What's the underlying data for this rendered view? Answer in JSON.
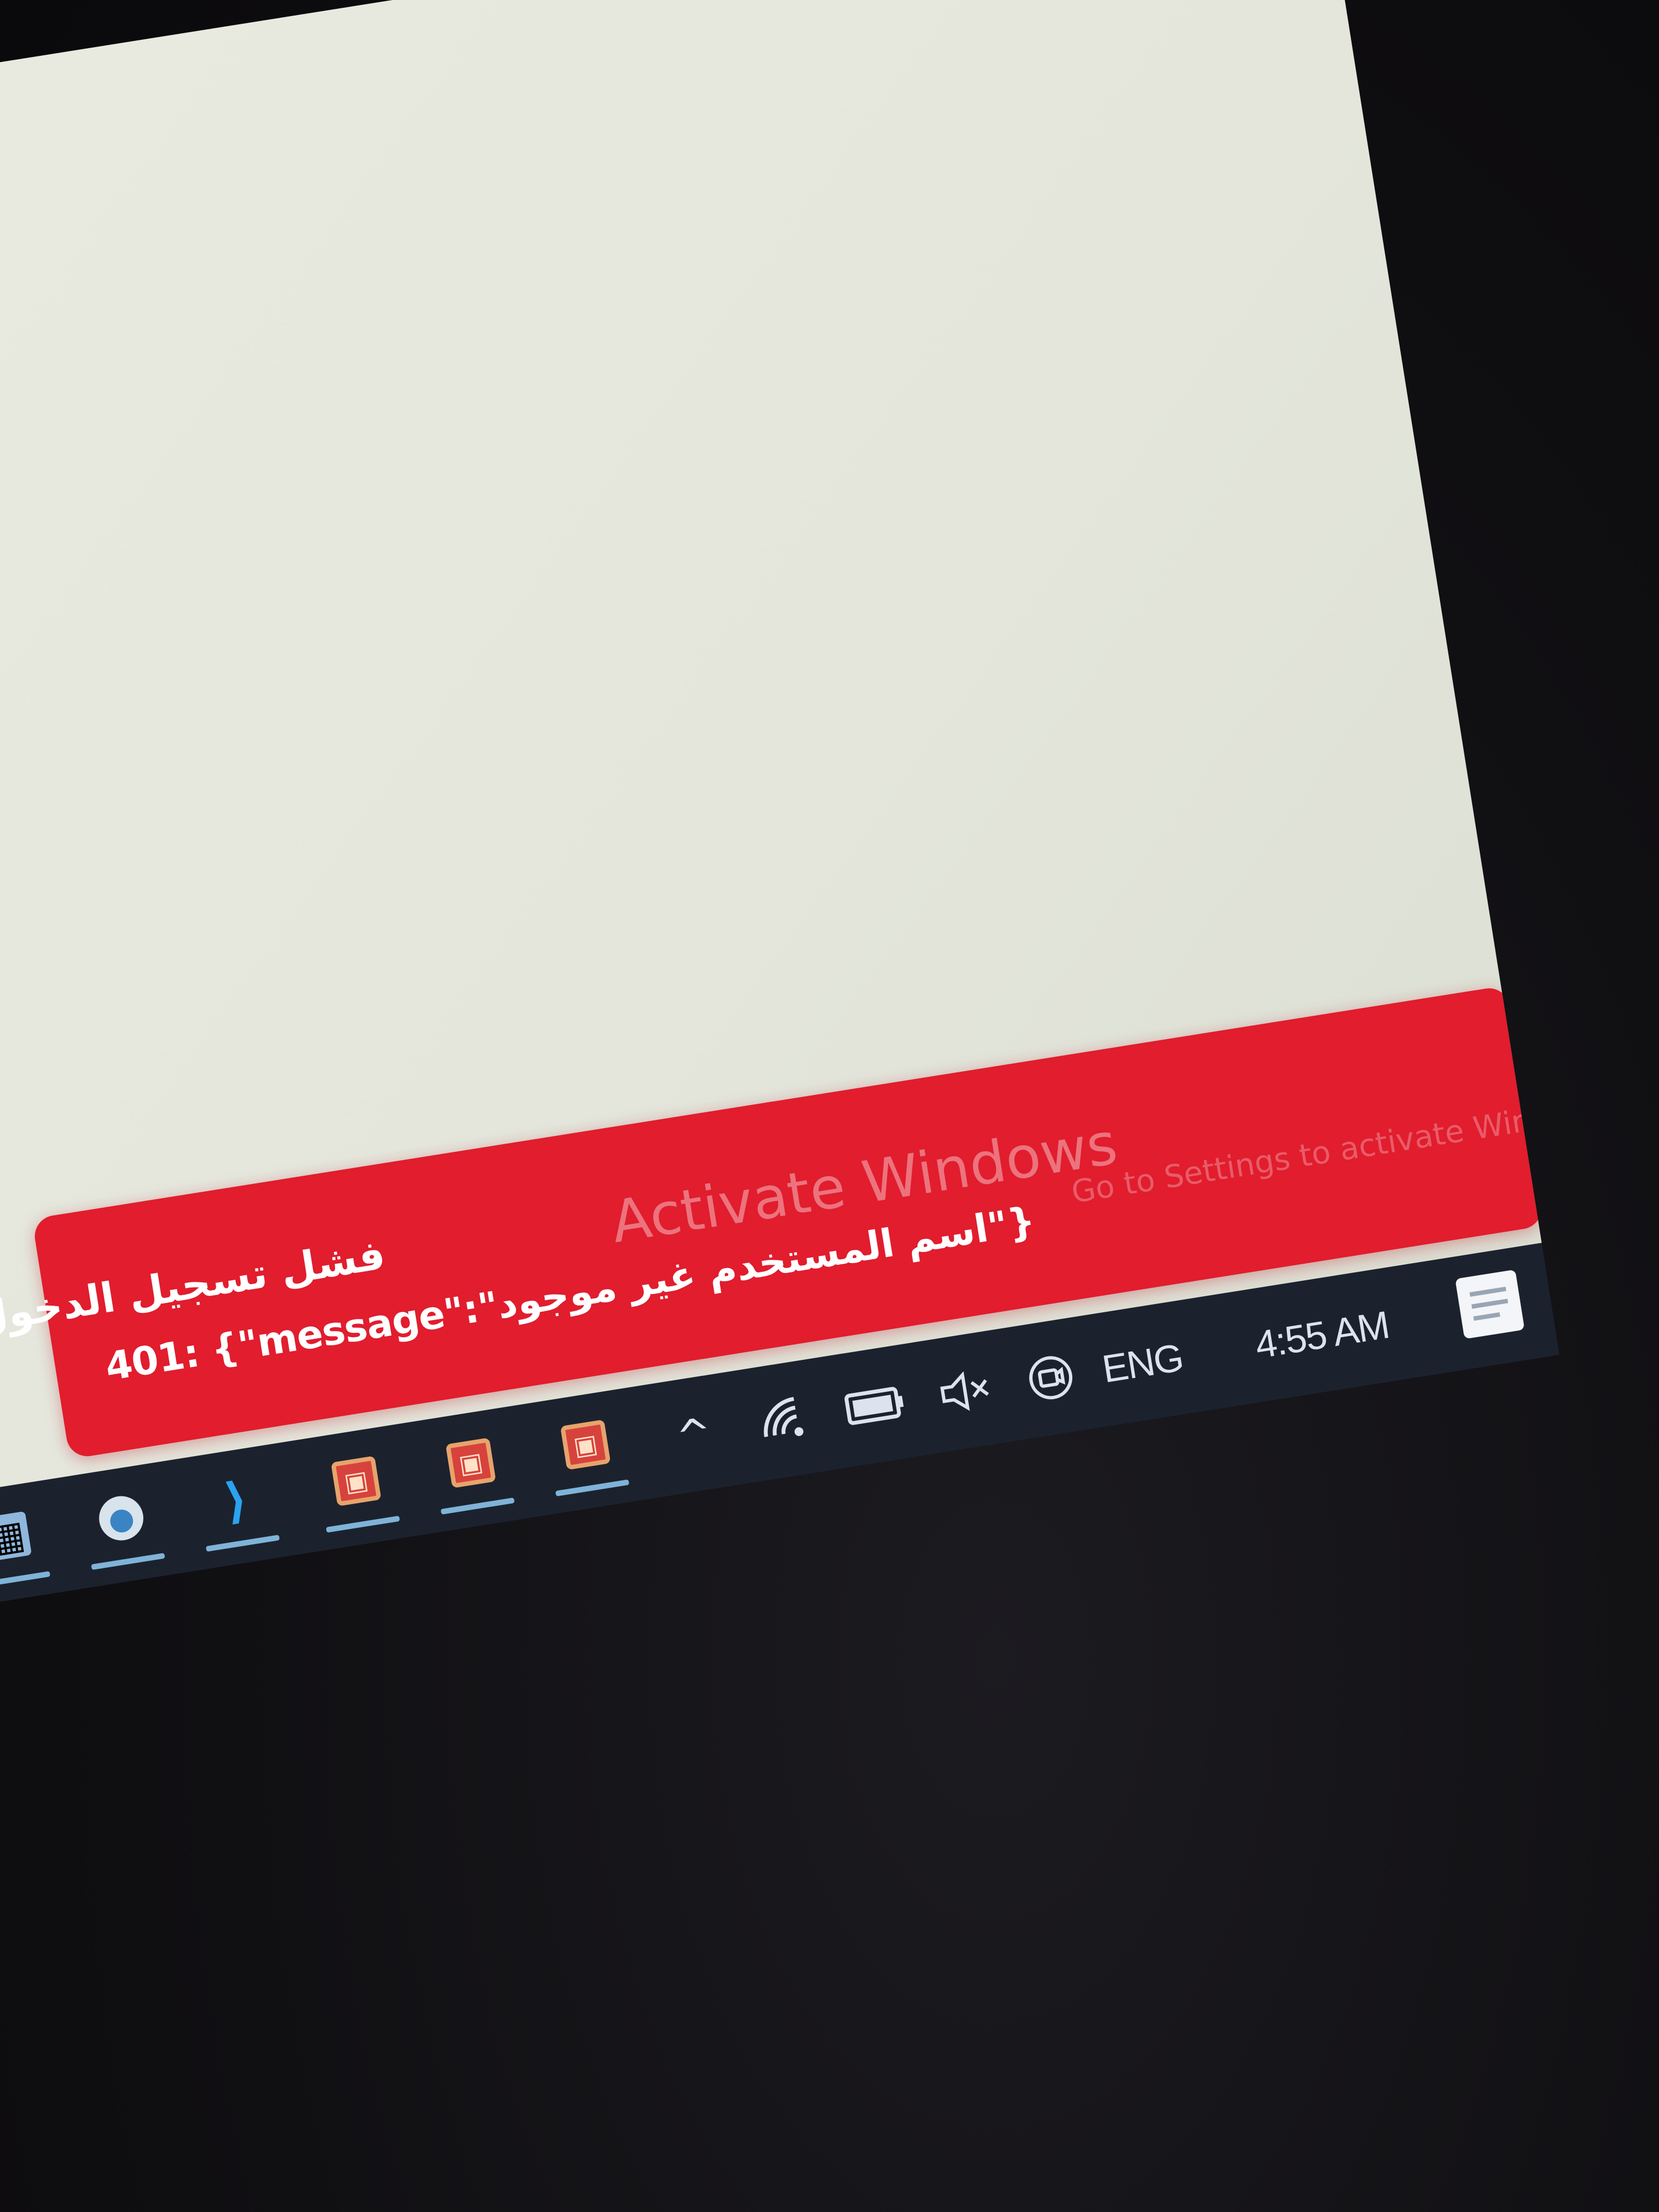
{
  "notification": {
    "title": "فشل تسجيل الدخول",
    "message": "401: {\"message\":\"اسم المستخدم غير موجود\"}",
    "watermark_line_1": "Activate Windows",
    "watermark_line_2": "Go to Settings to activate Windows."
  },
  "taskbar": {
    "apps": [
      {
        "name": "file-explorer",
        "glyph": "▦"
      },
      {
        "name": "chat",
        "glyph": "●"
      },
      {
        "name": "vscode",
        "glyph": "⟩"
      },
      {
        "name": "red-app-1",
        "glyph": "▣"
      },
      {
        "name": "red-app-2",
        "glyph": "▣"
      },
      {
        "name": "red-app-3",
        "glyph": "▣"
      }
    ],
    "tray": {
      "chevron": "^",
      "language": "ENG",
      "clock": "4:55 AM",
      "icons": [
        "chevron-up-icon",
        "wifi-icon",
        "battery-icon",
        "volume-muted-icon",
        "meet-now-icon"
      ]
    }
  },
  "colors": {
    "toast_background": "#e11d2e",
    "desktop_background": "#e6e8de",
    "taskbar_background": "#1b222e",
    "tray_text": "#dbe3ee"
  }
}
